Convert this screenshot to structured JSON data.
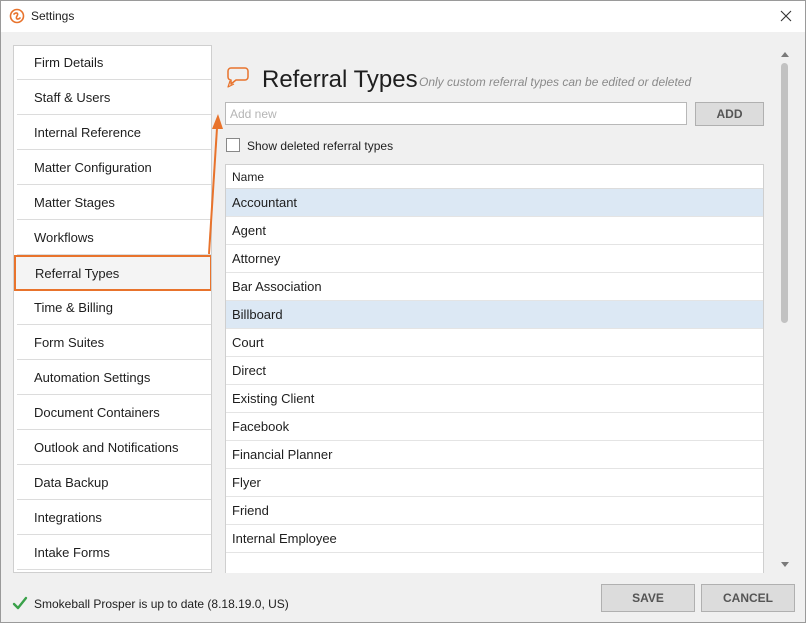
{
  "window": {
    "title": "Settings"
  },
  "icons": {
    "app": "smokeball-logo-icon",
    "close": "close-icon",
    "section": "chat-bubble-icon",
    "status": "checkmark-icon",
    "scroll_up": "chevron-up-icon",
    "scroll_down": "chevron-down-icon"
  },
  "colors": {
    "accent": "#e8732c",
    "selected_row": "#dce8f4",
    "status_ok": "#3aa14a"
  },
  "sidebar": {
    "items": [
      {
        "label": "Firm Details"
      },
      {
        "label": "Staff & Users"
      },
      {
        "label": "Internal Reference"
      },
      {
        "label": "Matter Configuration"
      },
      {
        "label": "Matter Stages"
      },
      {
        "label": "Workflows"
      },
      {
        "label": "Referral Types",
        "selected": true
      },
      {
        "label": "Time & Billing"
      },
      {
        "label": "Form Suites"
      },
      {
        "label": "Automation Settings"
      },
      {
        "label": "Document Containers"
      },
      {
        "label": "Outlook and Notifications"
      },
      {
        "label": "Data Backup"
      },
      {
        "label": "Integrations"
      },
      {
        "label": "Intake Forms"
      }
    ]
  },
  "main": {
    "title": "Referral Types",
    "subtitle": "Only custom referral types can be edited or deleted",
    "add_input": {
      "placeholder": "Add new",
      "value": ""
    },
    "add_button": "ADD",
    "show_deleted": {
      "label": "Show deleted referral types",
      "checked": false
    },
    "table": {
      "column": "Name",
      "rows": [
        {
          "name": "Accountant",
          "selected": true
        },
        {
          "name": "Agent"
        },
        {
          "name": "Attorney"
        },
        {
          "name": "Bar Association"
        },
        {
          "name": "Billboard",
          "selected": true
        },
        {
          "name": "Court"
        },
        {
          "name": "Direct"
        },
        {
          "name": "Existing Client"
        },
        {
          "name": "Facebook"
        },
        {
          "name": "Financial Planner"
        },
        {
          "name": "Flyer"
        },
        {
          "name": "Friend"
        },
        {
          "name": "Internal Employee"
        },
        {
          "name": ""
        }
      ]
    }
  },
  "footer": {
    "status_text": "Smokeball Prosper is up to date (8.18.19.0, US)",
    "save_label": "SAVE",
    "cancel_label": "CANCEL"
  }
}
